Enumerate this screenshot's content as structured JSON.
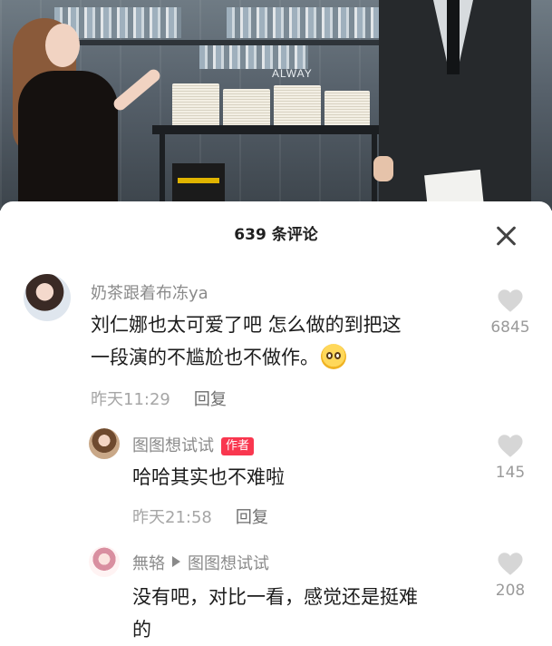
{
  "video": {
    "sign_text": "ALWAY"
  },
  "sheet": {
    "title": "639 条评论"
  },
  "comments": [
    {
      "author": "奶茶跟着布冻ya",
      "text_line1": "刘仁娜也太可爱了吧 怎么做的到把这",
      "text_line2": "一段演的不尴尬也不做作。",
      "emoji": "pleading-face-emoji",
      "time": "昨天11:29",
      "reply_label": "回复",
      "likes": "6845"
    },
    {
      "author": "图图想试试",
      "badge": "作者",
      "text_line1": "哈哈其实也不难啦",
      "time": "昨天21:58",
      "reply_label": "回复",
      "likes": "145"
    },
    {
      "author": "無辂",
      "reply_to": "图图想试试",
      "text_line1": "没有吧，对比一看，感觉还是挺难",
      "text_line2": "的",
      "likes": "208"
    }
  ],
  "colors": {
    "badge": "#f9374f",
    "heart": "#d6d6d6",
    "meta": "#a6a6a6"
  }
}
